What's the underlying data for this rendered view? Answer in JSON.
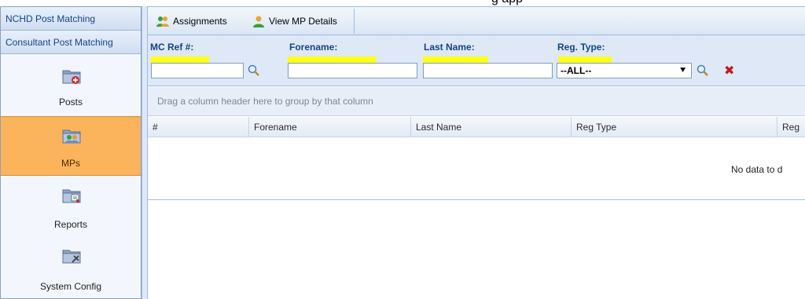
{
  "caption_text": "g        app",
  "sidebar": {
    "headers": [
      {
        "label": "NCHD Post Matching"
      },
      {
        "label": "Consultant Post Matching"
      }
    ],
    "items": [
      {
        "label": "Posts",
        "icon": "folder-add-icon"
      },
      {
        "label": "MPs",
        "icon": "folder-people-icon",
        "active": true
      },
      {
        "label": "Reports",
        "icon": "folder-report-icon"
      },
      {
        "label": "System Config",
        "icon": "folder-settings-icon"
      }
    ]
  },
  "toolbar": {
    "assignments_label": "Assignments",
    "view_details_label": "View MP Details"
  },
  "filters": {
    "mc_ref_label": "MC Ref #:",
    "forename_label": "Forename:",
    "last_name_label": "Last Name:",
    "reg_type_label": "Reg. Type:",
    "reg_type_value": "--ALL--"
  },
  "grid": {
    "group_hint": "Drag a column header here to group by that column",
    "columns": [
      "#",
      "Forename",
      "Last Name",
      "Reg Type",
      "Reg"
    ],
    "empty_text": "No data to d"
  },
  "colors": {
    "accent_active": "#fbb45b",
    "header_blue": "#15428b",
    "highlight": "#ffff1a",
    "delete_red": "#c8161d"
  }
}
